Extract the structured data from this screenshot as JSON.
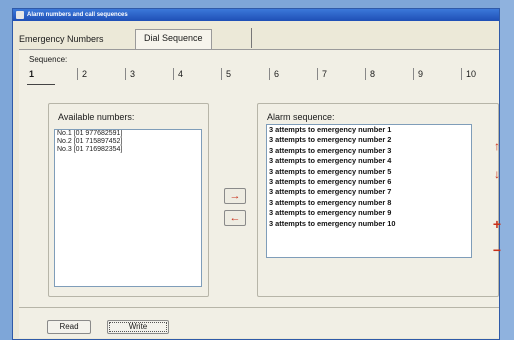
{
  "window": {
    "title": "Alarm numbers and call sequences"
  },
  "tabs": [
    {
      "label": "Emergency Numbers",
      "active": false
    },
    {
      "label": "Dial Sequence",
      "active": true
    }
  ],
  "sequence": {
    "label": "Sequence:",
    "numbers": [
      "1",
      "2",
      "3",
      "4",
      "5",
      "6",
      "7",
      "8",
      "9",
      "10"
    ],
    "selected": "1"
  },
  "available": {
    "title": "Available numbers:",
    "items": [
      "No.1 [01 977682591]",
      "No.2 [01 715897452]",
      "No.3 [01 716982354]"
    ]
  },
  "alarm": {
    "title": "Alarm sequence:",
    "items": [
      "3 attempts to emergency number 1",
      "3 attempts to emergency number 2",
      "3 attempts to emergency number 3",
      "3 attempts to emergency number 4",
      "3 attempts to emergency number 5",
      "3 attempts to emergency number 6",
      "3 attempts to emergency number 7",
      "3 attempts to emergency number 8",
      "3 attempts to emergency number 9",
      "3 attempts to emergency number 10"
    ]
  },
  "controls": {
    "add_symbol": "→",
    "remove_symbol": "←",
    "move_up_symbol": "↑",
    "move_down_symbol": "↓",
    "increase_symbol": "+",
    "decrease_symbol": "−"
  },
  "buttons": {
    "read": "Read",
    "write": "Write"
  },
  "colors": {
    "titlebar": "#1f4fb5",
    "arrow_accent": "#c8301a"
  }
}
